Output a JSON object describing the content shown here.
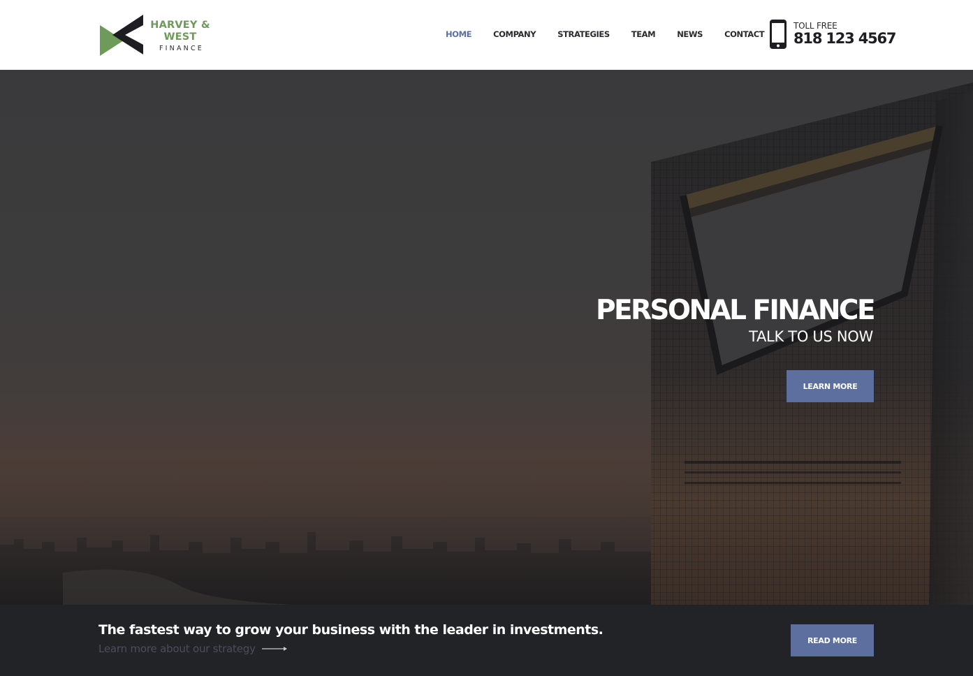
{
  "brand": {
    "name_line1": "HARVEY &",
    "name_line2": "WEST",
    "name_line3": "FINANCE",
    "accent_color": "#6e9a5a",
    "mark_dark_color": "#1e1e22"
  },
  "nav": {
    "items": [
      {
        "label": "HOME",
        "active": true
      },
      {
        "label": "COMPANY",
        "active": false
      },
      {
        "label": "STRATEGIES",
        "active": false
      },
      {
        "label": "TEAM",
        "active": false
      },
      {
        "label": "NEWS",
        "active": false
      },
      {
        "label": "CONTACT",
        "active": false
      }
    ],
    "active_color": "#5c6f9e"
  },
  "contact": {
    "label": "TOLL FREE",
    "phone": "818 123 4567",
    "icon": "mobile-phone-icon"
  },
  "hero": {
    "title": "PERSONAL FINANCE",
    "subtitle": "TALK TO US NOW",
    "button_label": "LEARN MORE"
  },
  "cta_bar": {
    "title": "The fastest way to grow your business with the leader in investments.",
    "link_text": "Learn more about our strategy",
    "link_icon": "arrow-right-icon",
    "button_label": "READ MORE"
  },
  "colors": {
    "button": "#5c6f9e",
    "bar_background": "#222327"
  }
}
